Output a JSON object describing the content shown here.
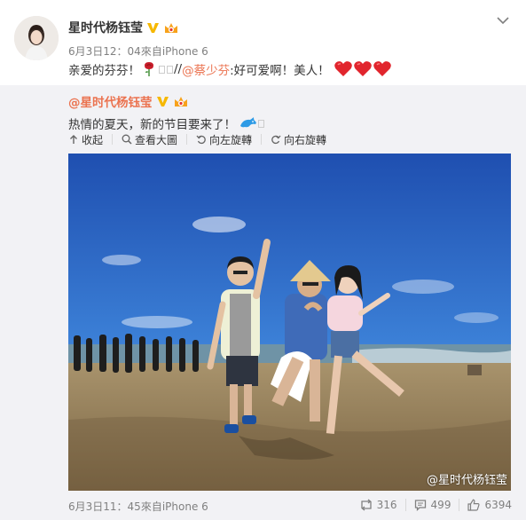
{
  "post": {
    "username": "星时代杨钰莹",
    "date": "6月3日12：04",
    "source_prefix": "來自",
    "source": "iPhone 6",
    "text_part1": "亲爱的芬芬！",
    "text_sep": " //",
    "mention": "@蔡少芬",
    "text_part2": ":好可爱啊！美人！"
  },
  "repost": {
    "username": "@星时代杨钰莹",
    "text": "热情的夏天，新的节目要来了！",
    "actions": {
      "collapse": "收起",
      "view_large": "查看大圖",
      "rotate_left": "向左旋轉",
      "rotate_right": "向右旋轉"
    },
    "watermark": "@星时代杨钰莹",
    "date": "6月3日11：45",
    "source_prefix": "來自",
    "source": "iPhone 6",
    "stats": {
      "reposts": "316",
      "comments": "499",
      "likes": "6394"
    }
  },
  "colors": {
    "mention": "#eb7350",
    "repost_bg": "#f2f2f5",
    "verified": "#f6b800",
    "heart": "#e1252d"
  },
  "icons": [
    "verified-v-icon",
    "member-badge-icon",
    "chevron-down-icon",
    "rose-emoji-icon",
    "heart-emoji-icon",
    "dolphin-emoji-icon",
    "collapse-arrow-icon",
    "magnify-icon",
    "rotate-left-icon",
    "rotate-right-icon",
    "repost-icon",
    "comment-icon",
    "like-icon"
  ]
}
